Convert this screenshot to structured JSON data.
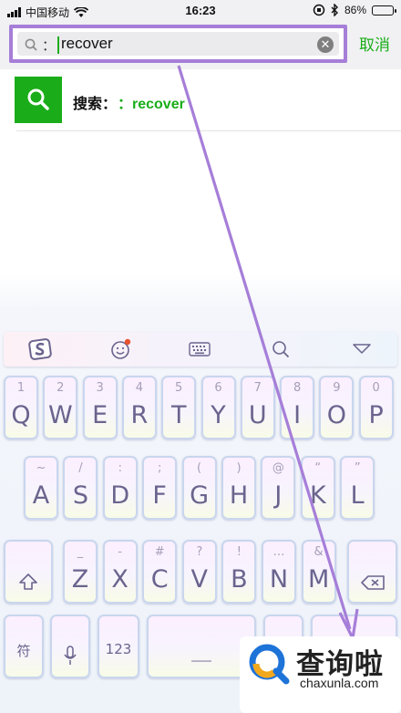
{
  "status_bar": {
    "carrier": "中国移动",
    "time": "16:23",
    "battery": "86%",
    "battery_level": 0.86
  },
  "search": {
    "prefix": "：",
    "query": "recover",
    "cancel_label": "取消"
  },
  "result": {
    "label": "搜索：",
    "query": "：recover"
  },
  "keyboard": {
    "toolbar": [
      "sogou-logo-icon",
      "emoji-icon",
      "keyboard-icon",
      "search-icon",
      "collapse-icon"
    ],
    "row1": [
      {
        "hint": "1",
        "key": "Q"
      },
      {
        "hint": "2",
        "key": "W"
      },
      {
        "hint": "3",
        "key": "E"
      },
      {
        "hint": "4",
        "key": "R"
      },
      {
        "hint": "5",
        "key": "T"
      },
      {
        "hint": "6",
        "key": "Y"
      },
      {
        "hint": "7",
        "key": "U"
      },
      {
        "hint": "8",
        "key": "I"
      },
      {
        "hint": "9",
        "key": "O"
      },
      {
        "hint": "0",
        "key": "P"
      }
    ],
    "row2": [
      {
        "hint": "~",
        "key": "A"
      },
      {
        "hint": "/",
        "key": "S"
      },
      {
        "hint": ":",
        "key": "D"
      },
      {
        "hint": ";",
        "key": "F"
      },
      {
        "hint": "(",
        "key": "G"
      },
      {
        "hint": ")",
        "key": "H"
      },
      {
        "hint": "@",
        "key": "J"
      },
      {
        "hint": "“",
        "key": "K"
      },
      {
        "hint": "”",
        "key": "L"
      }
    ],
    "row3": [
      {
        "hint": "_",
        "key": "Z"
      },
      {
        "hint": "-",
        "key": "X"
      },
      {
        "hint": "#",
        "key": "C"
      },
      {
        "hint": "?",
        "key": "V"
      },
      {
        "hint": "!",
        "key": "B"
      },
      {
        "hint": "…",
        "key": "N"
      },
      {
        "hint": "&",
        "key": "M"
      }
    ],
    "symbol_key": "符",
    "num_key": "123",
    "space_key": "＿"
  },
  "watermark": {
    "title": "查询啦",
    "domain": "chaxunla.com"
  },
  "colors": {
    "accent_green": "#1aad19",
    "annotation_purple": "#a67ed8"
  }
}
